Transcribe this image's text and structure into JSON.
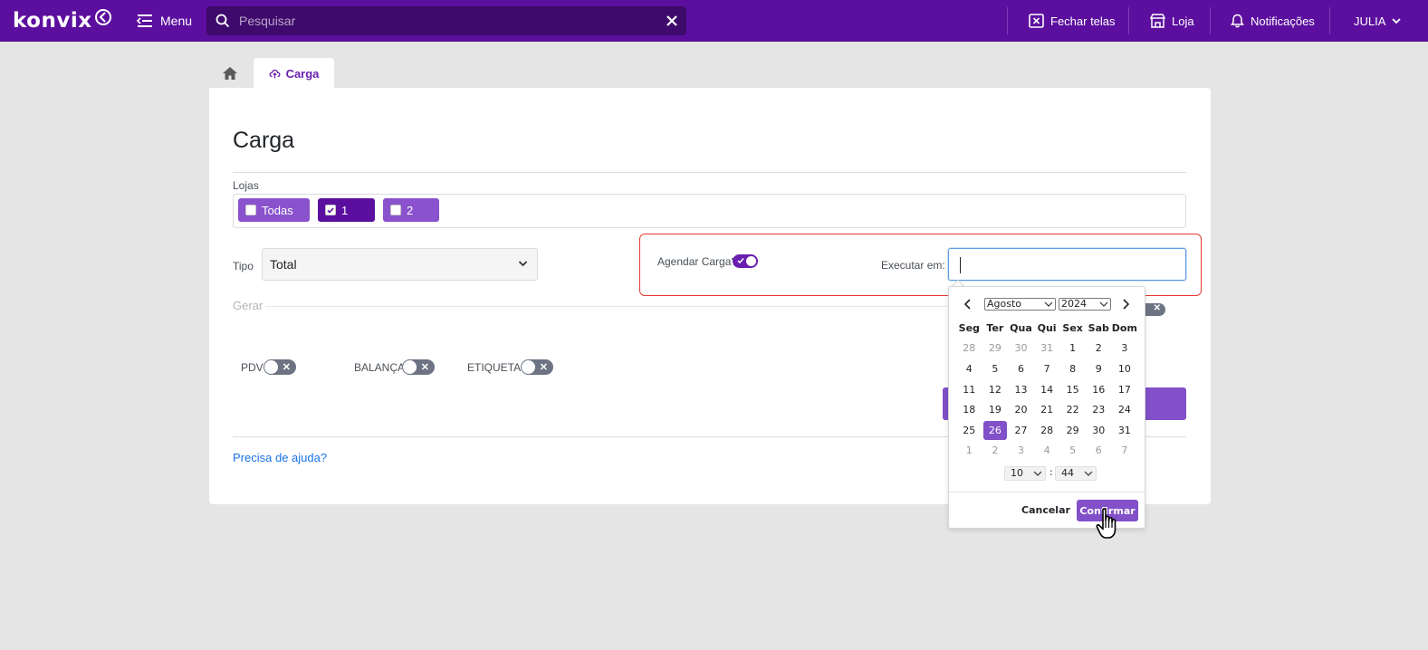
{
  "app": {
    "brand": "Konvix",
    "menu_label": "Menu",
    "search": {
      "placeholder": "Pesquisar",
      "value": ""
    },
    "nav": {
      "close_screens": "Fechar telas",
      "store": "Loja",
      "notifications": "Notificações",
      "user": "JULIA"
    },
    "colors": {
      "primary": "#5c0f9e",
      "accent": "#8250c8",
      "alert_border": "#e53935",
      "link": "#1a73e8"
    }
  },
  "tabs": {
    "home_icon": "home-icon",
    "active_label": "Carga",
    "active_icon": "cloud-upload-icon"
  },
  "page": {
    "title": "Carga",
    "lojas_label": "Lojas",
    "stores": [
      {
        "label": "Todas",
        "checked": false
      },
      {
        "label": "1",
        "checked": true
      },
      {
        "label": "2",
        "checked": false
      }
    ],
    "tipo_label": "Tipo",
    "tipo_value": "Total",
    "schedule_label": "Agendar Carga?",
    "schedule_on": true,
    "execute_label": "Executar em:",
    "execute_value": "",
    "gerar_label": "Gerar",
    "toggles": [
      {
        "label": "PDV",
        "on": false
      },
      {
        "label": "BALANÇA",
        "on": false
      },
      {
        "label": "ETIQUETAS",
        "on": false
      }
    ],
    "help_link": "Precisa de ajuda?"
  },
  "datepicker": {
    "month": "Agosto",
    "year": "2024",
    "weekdays": [
      "Seg",
      "Ter",
      "Qua",
      "Qui",
      "Sex",
      "Sab",
      "Dom"
    ],
    "days": [
      "28",
      "29",
      "30",
      "31",
      "1",
      "2",
      "3",
      "4",
      "5",
      "6",
      "7",
      "8",
      "9",
      "10",
      "11",
      "12",
      "13",
      "14",
      "15",
      "16",
      "17",
      "18",
      "19",
      "20",
      "21",
      "22",
      "23",
      "24",
      "25",
      "26",
      "27",
      "28",
      "29",
      "30",
      "31",
      "1",
      "2",
      "3",
      "4",
      "5",
      "6",
      "7"
    ],
    "muted_indices": [
      0,
      1,
      2,
      3,
      35,
      36,
      37,
      38,
      39,
      40,
      41
    ],
    "selected_index": 29,
    "hour": "10",
    "minute": "44",
    "cancel_label": "Cancelar",
    "confirm_label": "Confirmar"
  }
}
